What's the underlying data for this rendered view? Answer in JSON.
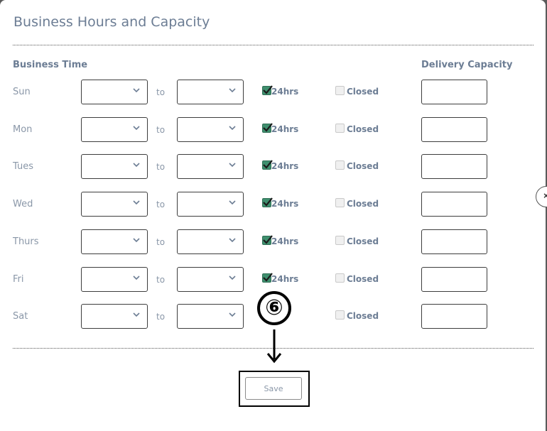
{
  "modal": {
    "title": "Business Hours and Capacity",
    "headers": {
      "business_time": "Business Time",
      "delivery_capacity": "Delivery Capacity"
    },
    "to_label": "to",
    "all_day_label": "24hrs",
    "closed_label": "Closed",
    "days": [
      {
        "label": "Sun",
        "all_day": true,
        "closed": false,
        "all_day_label_visible": true
      },
      {
        "label": "Mon",
        "all_day": true,
        "closed": false,
        "all_day_label_visible": true
      },
      {
        "label": "Tues",
        "all_day": true,
        "closed": false,
        "all_day_label_visible": true
      },
      {
        "label": "Wed",
        "all_day": true,
        "closed": false,
        "all_day_label_visible": true
      },
      {
        "label": "Thurs",
        "all_day": true,
        "closed": false,
        "all_day_label_visible": true
      },
      {
        "label": "Fri",
        "all_day": true,
        "closed": false,
        "all_day_label_visible": true
      },
      {
        "label": "Sat",
        "all_day": true,
        "closed": false,
        "all_day_label_visible": false
      }
    ],
    "save_label": "Save",
    "side_close_label": "×"
  },
  "annotation": {
    "step_number": "⑥"
  },
  "colors": {
    "checkbox_checked": "#3f8f6e",
    "label_text": "#6c7d94",
    "muted_text": "#8a97a8"
  },
  "icons": {
    "select_arrow": "chevron-down-icon",
    "check": "check-icon",
    "side_close": "close-icon",
    "annotation_arrow": "arrow-down-icon"
  }
}
